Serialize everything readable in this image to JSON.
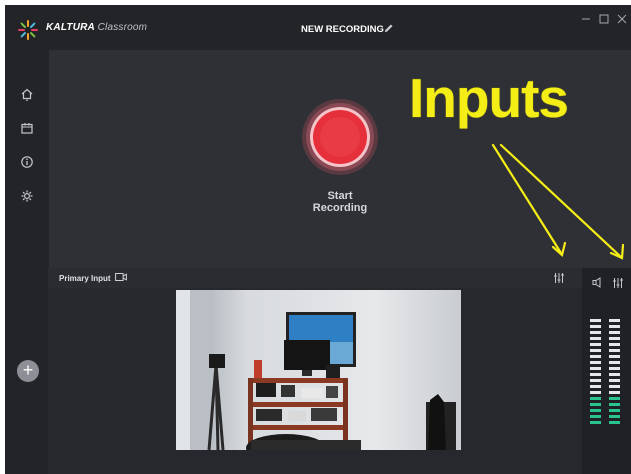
{
  "app": {
    "brand_name": "KALTURA",
    "brand_product": "Classroom",
    "recording_title": "NEW RECORDING"
  },
  "window_controls": [
    "minimize",
    "maximize",
    "close"
  ],
  "sidebar": {
    "items": [
      {
        "icon": "home-icon"
      },
      {
        "icon": "calendar-icon"
      },
      {
        "icon": "info-icon"
      },
      {
        "icon": "settings-icon"
      }
    ]
  },
  "main": {
    "record_button_label": "Start Recording",
    "annotation": "Inputs"
  },
  "input_panel": {
    "label": "Primary Input"
  },
  "audio": {
    "meter_left_active": 5,
    "meter_right_active": 5,
    "meter_total": 18
  },
  "colors": {
    "record": "#e5303b",
    "annotation": "#f4ee16",
    "meter_active": "#29c38e",
    "meter_idle": "#e6e7ea"
  }
}
